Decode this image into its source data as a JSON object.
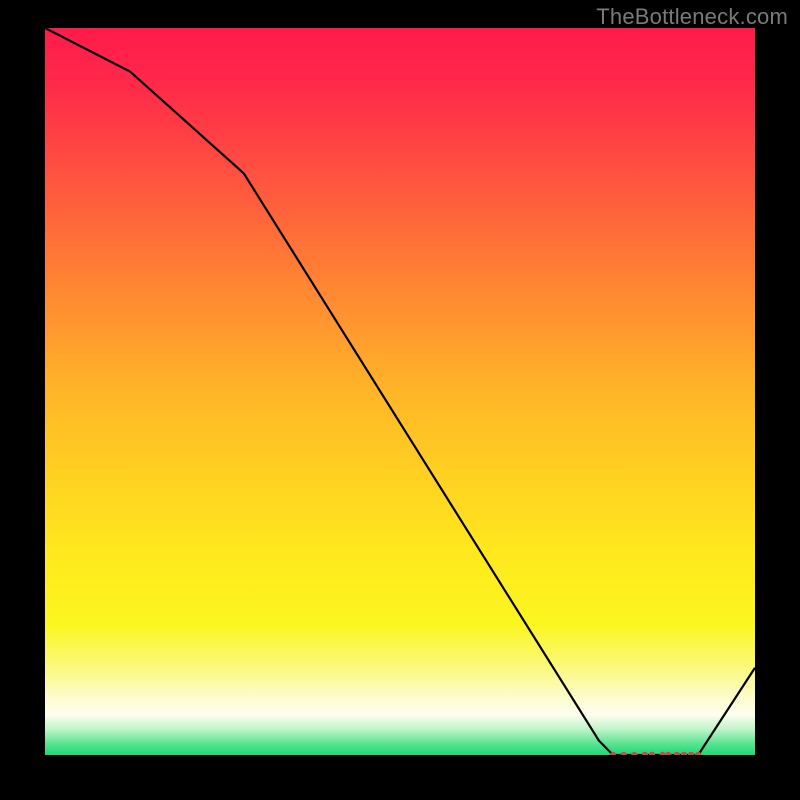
{
  "watermark": "TheBottleneck.com",
  "chart_data": {
    "type": "line",
    "title": "",
    "xlabel": "",
    "ylabel": "",
    "xlim": [
      0,
      100
    ],
    "ylim": [
      0,
      100
    ],
    "x": [
      0,
      12,
      28,
      78,
      80,
      92,
      100
    ],
    "values": [
      100,
      94,
      80,
      2,
      0,
      0,
      12
    ],
    "marker_x": [
      80,
      81.5,
      83,
      84.5,
      85.5,
      87,
      87.8,
      89,
      90,
      91,
      92
    ],
    "marker_values": [
      0,
      0,
      0,
      0,
      0,
      0,
      0,
      0,
      0,
      0,
      0
    ],
    "gradient_stops": [
      {
        "offset": 0.0,
        "color": "#ff1b4b"
      },
      {
        "offset": 0.08,
        "color": "#ff2a49"
      },
      {
        "offset": 0.2,
        "color": "#ff5140"
      },
      {
        "offset": 0.35,
        "color": "#ff8433"
      },
      {
        "offset": 0.5,
        "color": "#ffb528"
      },
      {
        "offset": 0.62,
        "color": "#ffd221"
      },
      {
        "offset": 0.72,
        "color": "#ffe81e"
      },
      {
        "offset": 0.82,
        "color": "#fbf61f"
      },
      {
        "offset": 0.885,
        "color": "#fbf988"
      },
      {
        "offset": 0.92,
        "color": "#fdfccb"
      },
      {
        "offset": 0.945,
        "color": "#fefef0"
      },
      {
        "offset": 0.965,
        "color": "#bdf4c9"
      },
      {
        "offset": 0.985,
        "color": "#57e38e"
      },
      {
        "offset": 1.0,
        "color": "#1fd877"
      }
    ],
    "line_color": "#000000",
    "marker_color": "#c94a4a"
  }
}
